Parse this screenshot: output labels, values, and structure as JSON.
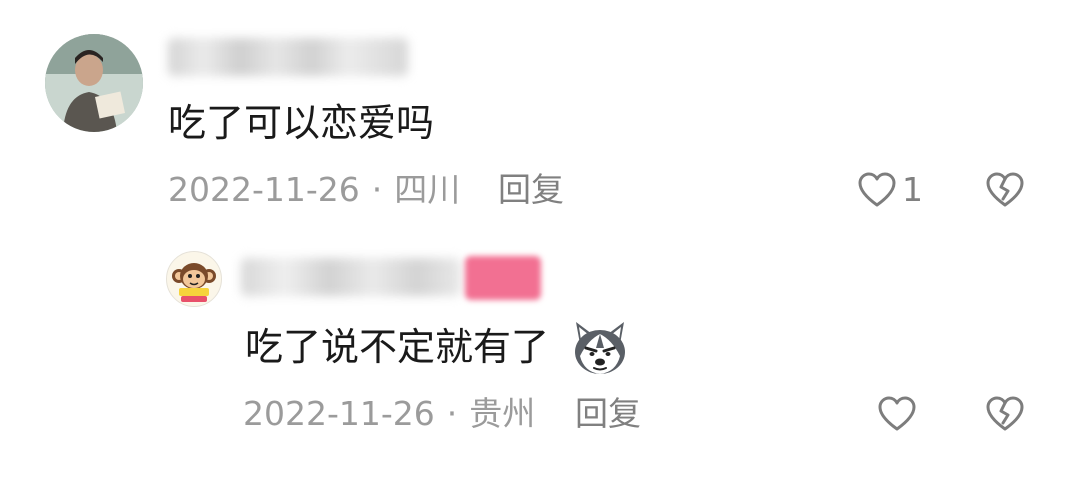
{
  "comments": [
    {
      "text": "吃了可以恋爱吗",
      "date": "2022-11-26",
      "separator": "·",
      "location": "四川",
      "reply_label": "回复",
      "like_count": "1"
    }
  ],
  "replies": [
    {
      "text": "吃了说不定就有了",
      "sticker": "husky-dog-sticker",
      "date": "2022-11-26",
      "separator": "·",
      "location": "贵州",
      "reply_label": "回复"
    }
  ],
  "icons": {
    "like": "heart-outline-icon",
    "dislike": "broken-heart-icon"
  },
  "colors": {
    "text": "#1a1a1a",
    "meta": "#9b9b9b",
    "action": "#808080",
    "tag": "#f27092"
  }
}
